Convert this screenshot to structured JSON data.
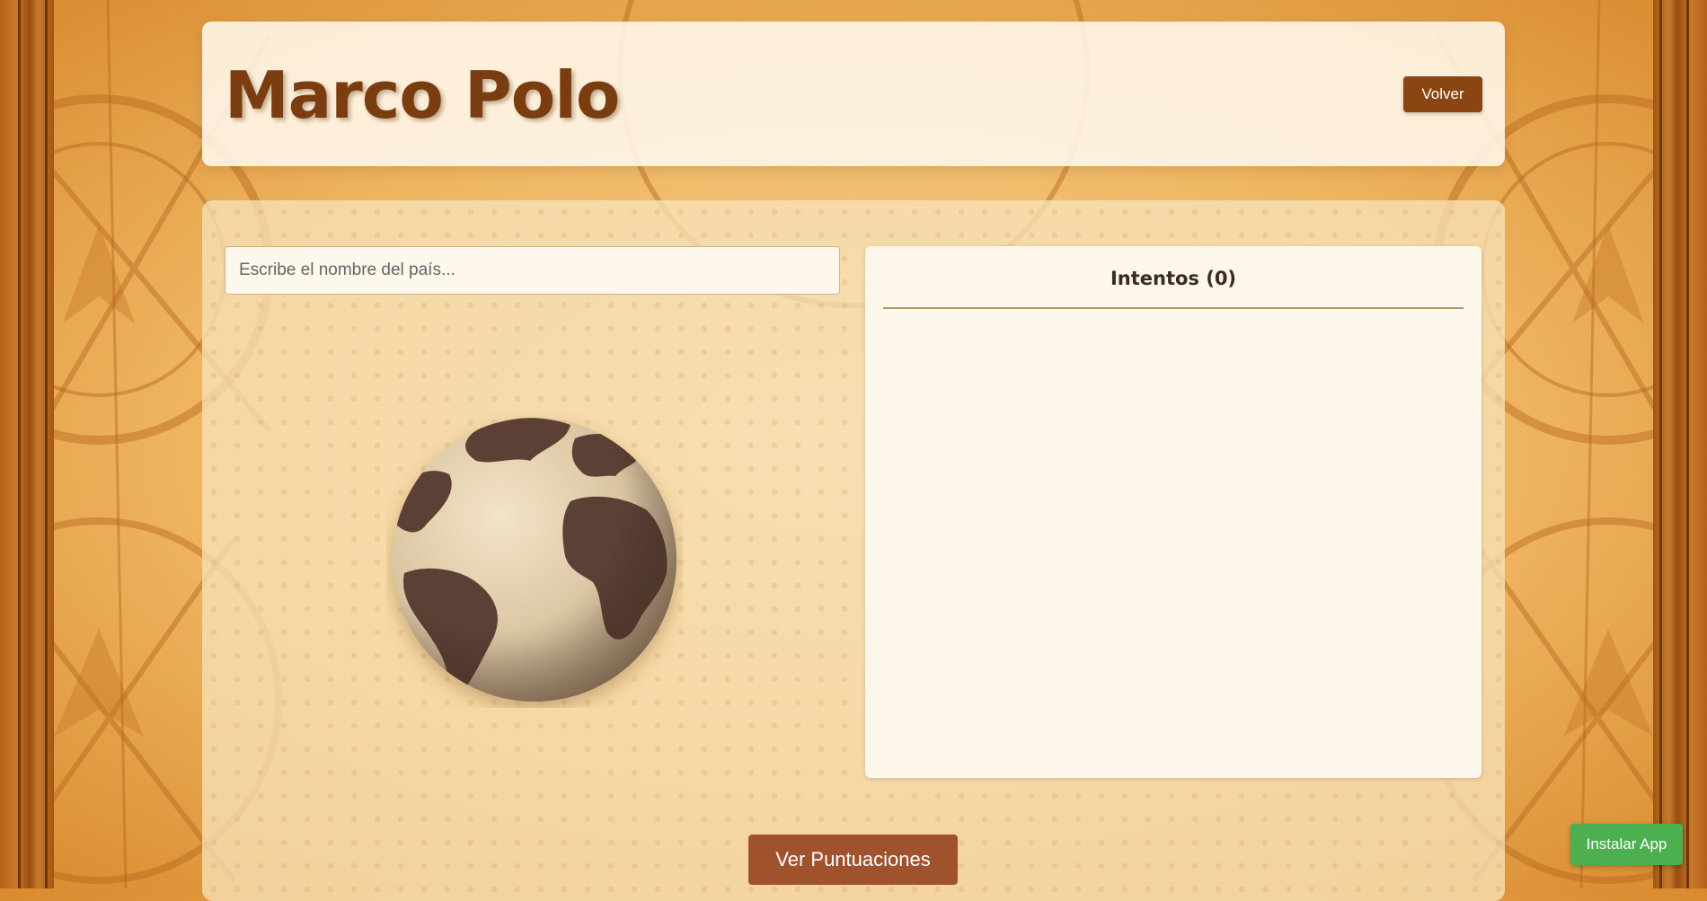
{
  "header": {
    "title": "Marco Polo",
    "back_label": "Volver"
  },
  "search": {
    "placeholder": "Escribe el nombre del país..."
  },
  "attempts": {
    "title": "Intentos (0)",
    "items": []
  },
  "actions": {
    "scores_label": "Ver Puntuaciones",
    "install_label": "Instalar App"
  },
  "colors": {
    "brand_brown": "#8b4513",
    "scores_button": "#a0522d",
    "install_button": "#4caf50"
  },
  "icons": {
    "globe": "globe-icon"
  }
}
